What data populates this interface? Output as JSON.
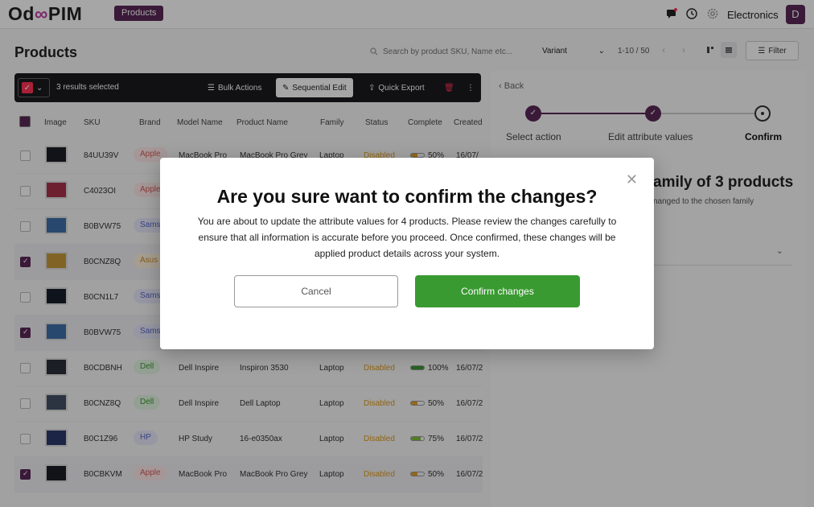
{
  "header": {
    "logo_left": "Od",
    "logo_mid": "∞",
    "logo_right": "PIM",
    "section_badge": "Products",
    "workspace": "Electronics",
    "avatar_initial": "D"
  },
  "page": {
    "title": "Products",
    "search_placeholder": "Search by product SKU, Name etc...",
    "variant_select": "Variant",
    "pager": "1-10 / 50",
    "filter_label": "Filter"
  },
  "selection_bar": {
    "count_text": "3 results selected",
    "bulk_actions": "Bulk Actions",
    "sequential_edit": "Sequential Edit",
    "quick_export": "Quick Export"
  },
  "table": {
    "columns": [
      "Image",
      "SKU",
      "Brand",
      "Model Name",
      "Product Name",
      "Family",
      "Status",
      "Complete",
      "Created"
    ],
    "rows": [
      {
        "sku": "84UU39V",
        "brand": "Apple",
        "model": "MacBook Pro",
        "name": "MacBook Pro Grey",
        "family": "Laptop",
        "status": "Disabled",
        "complete": "50%",
        "created": "16/07/",
        "checked": false
      },
      {
        "sku": "C4023OI",
        "brand": "Apple",
        "model": "",
        "name": "",
        "family": "",
        "status": "",
        "complete": "",
        "created": "",
        "checked": false
      },
      {
        "sku": "B0BVW75",
        "brand": "Samsung",
        "model": "",
        "name": "",
        "family": "",
        "status": "",
        "complete": "",
        "created": "",
        "checked": false
      },
      {
        "sku": "B0CNZ8Q",
        "brand": "Asus",
        "model": "",
        "name": "",
        "family": "",
        "status": "",
        "complete": "",
        "created": "",
        "checked": true
      },
      {
        "sku": "B0CN1L7",
        "brand": "Samsung",
        "model": "",
        "name": "",
        "family": "",
        "status": "",
        "complete": "",
        "created": "",
        "checked": false
      },
      {
        "sku": "B0BVW75",
        "brand": "Samsung",
        "model": "",
        "name": "",
        "family": "",
        "status": "",
        "complete": "",
        "created": "",
        "checked": true
      },
      {
        "sku": "B0CDBNH",
        "brand": "Dell",
        "model": "Dell Inspire",
        "name": "Inspiron 3530",
        "family": "Laptop",
        "status": "Disabled",
        "complete": "100%",
        "created": "16/07/2",
        "checked": false
      },
      {
        "sku": "B0CNZ8Q",
        "brand": "Dell",
        "model": "Dell Inspire",
        "name": "Dell Laptop",
        "family": "Laptop",
        "status": "Disabled",
        "complete": "50%",
        "created": "16/07/2",
        "checked": false
      },
      {
        "sku": "B0C1Z96",
        "brand": "HP",
        "model": "HP Study",
        "name": "16-e0350ax",
        "family": "Laptop",
        "status": "Disabled",
        "complete": "75%",
        "created": "16/07/2",
        "checked": false
      },
      {
        "sku": "B0CBKVM",
        "brand": "Apple",
        "model": "MacBook Pro",
        "name": "MacBook Pro Grey",
        "family": "Laptop",
        "status": "Disabled",
        "complete": "50%",
        "created": "16/07/2",
        "checked": true
      }
    ]
  },
  "right_panel": {
    "back_label": "Back",
    "steps": [
      "Select action",
      "Edit attribute values",
      "Confirm"
    ],
    "title_fragment": "amily of 3 products",
    "subtitle_fragment": "nanged to the chosen family"
  },
  "modal": {
    "title": "Are you sure want to confirm the changes?",
    "body": "You are about to update the attribute values for 4 products. Please review the changes carefully to ensure that all information is accurate before you proceed. Once confirmed, these changes will be applied product details across your system.",
    "cancel_label": "Cancel",
    "confirm_label": "Confirm changes"
  },
  "colors": {
    "brand_purple": "#5a2856",
    "confirm_green": "#3a9a32",
    "status_disabled": "#e09a1a"
  }
}
